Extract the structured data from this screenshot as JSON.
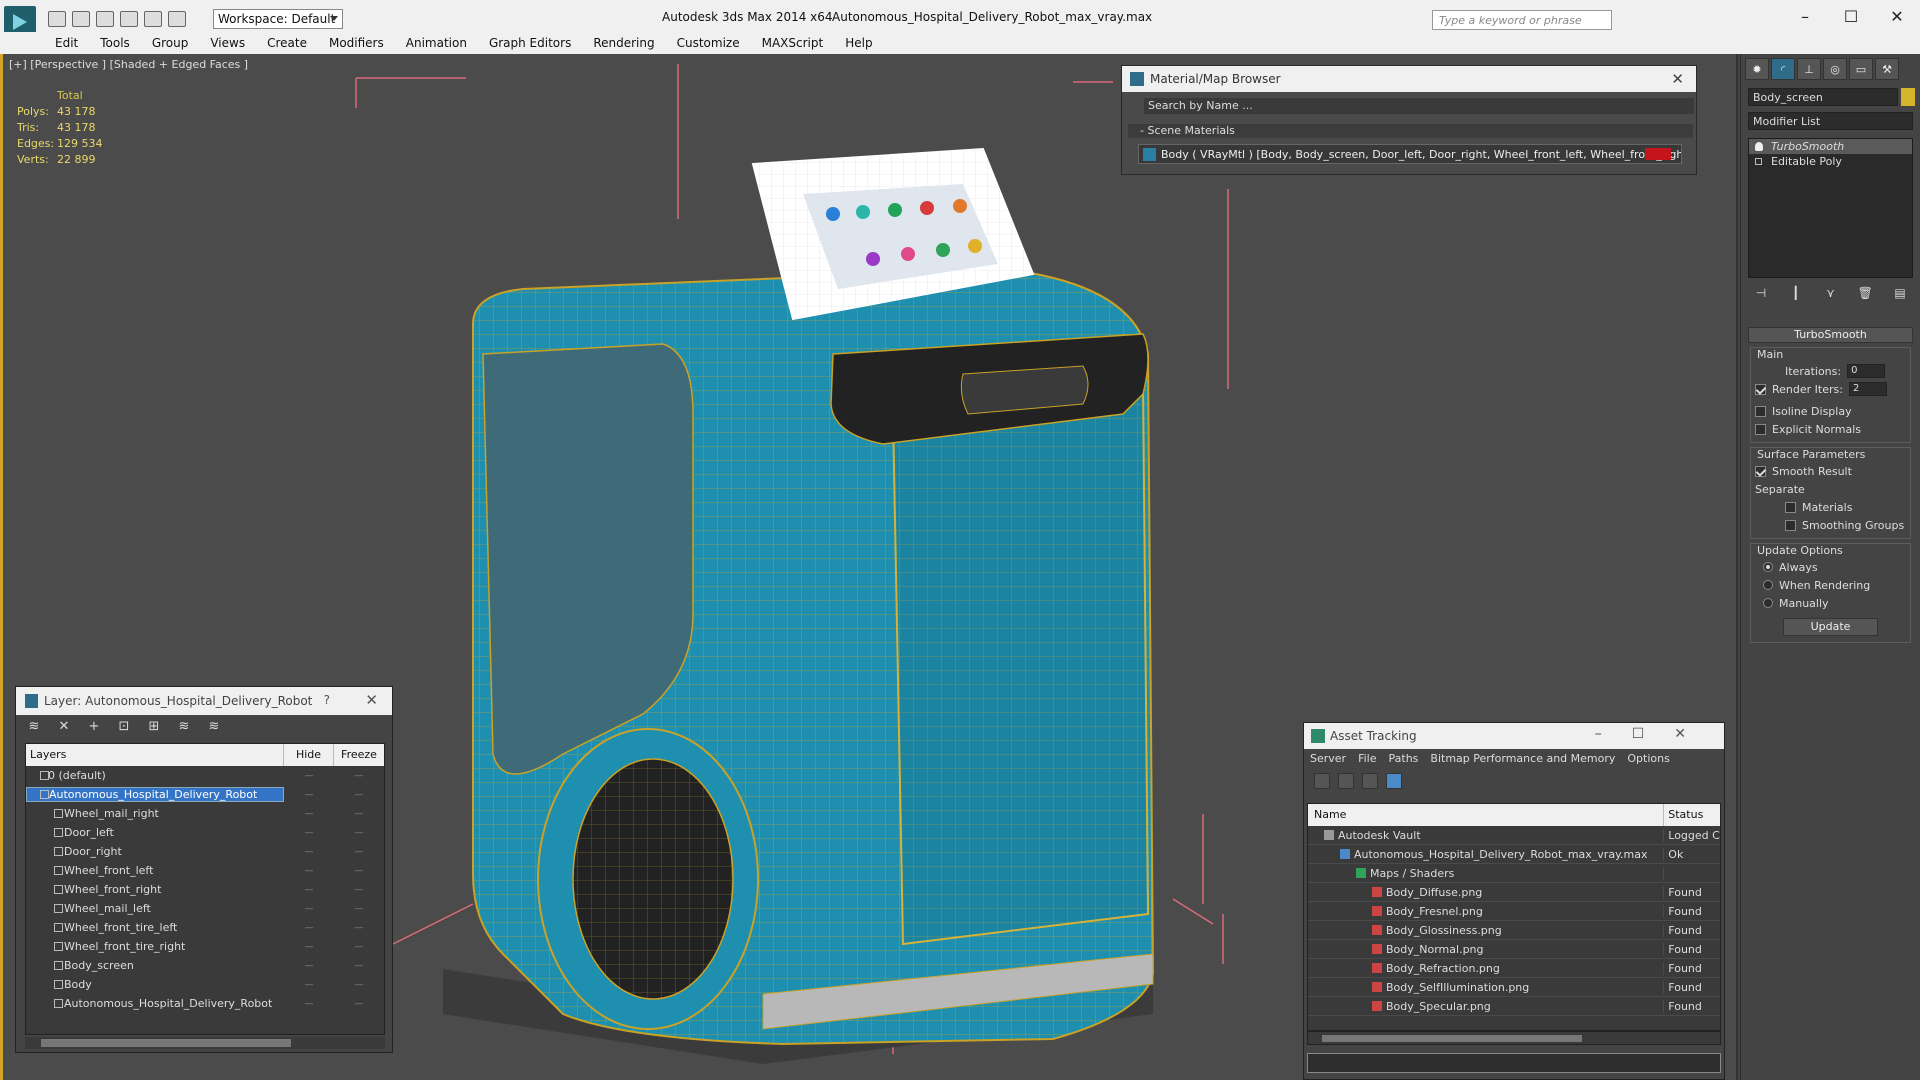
{
  "app": {
    "title": "Autodesk 3ds Max  2014 x64",
    "file": "Autonomous_Hospital_Delivery_Robot_max_vray.max",
    "workspace": "Workspace: Default",
    "search_placeholder": "Type a keyword or phrase"
  },
  "menu": [
    "Edit",
    "Tools",
    "Group",
    "Views",
    "Create",
    "Modifiers",
    "Animation",
    "Graph Editors",
    "Rendering",
    "Customize",
    "MAXScript",
    "Help"
  ],
  "viewport": {
    "label": "[+] [Perspective ] [Shaded + Edged Faces ]",
    "stats": {
      "header": "Total",
      "rows": [
        {
          "label": "Polys:",
          "value": "43 178"
        },
        {
          "label": "Tris:",
          "value": "43 178"
        },
        {
          "label": "Edges:",
          "value": "129 534"
        },
        {
          "label": "Verts:",
          "value": "22 899"
        }
      ]
    }
  },
  "command_panel": {
    "object_name": "Body_screen",
    "modifier_list": "Modifier List",
    "stack": [
      {
        "label": "TurboSmooth",
        "selected": true
      },
      {
        "label": "Editable Poly",
        "selected": false
      }
    ],
    "rollout_title": "TurboSmooth",
    "main_group": "Main",
    "iterations_label": "Iterations:",
    "iterations_value": "0",
    "render_iters_label": "Render Iters:",
    "render_iters_value": "2",
    "isoline_label": "Isoline Display",
    "explicit_normals_label": "Explicit Normals",
    "surface_group": "Surface Parameters",
    "smooth_result_label": "Smooth Result",
    "separate_label": "Separate",
    "materials_label": "Materials",
    "smoothing_groups_label": "Smoothing Groups",
    "update_group": "Update Options",
    "always_label": "Always",
    "when_rendering_label": "When Rendering",
    "manually_label": "Manually",
    "update_button": "Update"
  },
  "material_browser": {
    "title": "Material/Map Browser",
    "search": "Search by Name ...",
    "section": "- Scene Materials",
    "item": "Body ( VRayMtl ) [Body, Body_screen, Door_left, Door_right, Wheel_front_left, Wheel_front_right,..."
  },
  "layer_dialog": {
    "title": "Layer: Autonomous_Hospital_Delivery_Robot",
    "help": "?",
    "columns": {
      "layers": "Layers",
      "hide": "Hide",
      "freeze": "Freeze"
    },
    "rows": [
      {
        "name": "0 (default)",
        "type": "layer"
      },
      {
        "name": "Autonomous_Hospital_Delivery_Robot",
        "type": "layer",
        "selected": true
      },
      {
        "name": "Wheel_mail_right",
        "type": "obj"
      },
      {
        "name": "Door_left",
        "type": "obj"
      },
      {
        "name": "Door_right",
        "type": "obj"
      },
      {
        "name": "Wheel_front_left",
        "type": "obj"
      },
      {
        "name": "Wheel_front_right",
        "type": "obj"
      },
      {
        "name": "Wheel_mail_left",
        "type": "obj"
      },
      {
        "name": "Wheel_front_tire_left",
        "type": "obj"
      },
      {
        "name": "Wheel_front_tire_right",
        "type": "obj"
      },
      {
        "name": "Body_screen",
        "type": "obj"
      },
      {
        "name": "Body",
        "type": "obj"
      },
      {
        "name": "Autonomous_Hospital_Delivery_Robot",
        "type": "obj"
      }
    ]
  },
  "asset_tracking": {
    "title": "Asset Tracking",
    "menu": [
      "Server",
      "File",
      "Paths",
      "Bitmap Performance and Memory",
      "Options"
    ],
    "columns": {
      "name": "Name",
      "status": "Status"
    },
    "rows": [
      {
        "name": "Autodesk Vault",
        "status": "Logged C",
        "indent": 1
      },
      {
        "name": "Autonomous_Hospital_Delivery_Robot_max_vray.max",
        "status": "Ok",
        "indent": 2
      },
      {
        "name": "Maps / Shaders",
        "status": "",
        "indent": 3
      },
      {
        "name": "Body_Diffuse.png",
        "status": "Found",
        "indent": 4
      },
      {
        "name": "Body_Fresnel.png",
        "status": "Found",
        "indent": 4
      },
      {
        "name": "Body_Glossiness.png",
        "status": "Found",
        "indent": 4
      },
      {
        "name": "Body_Normal.png",
        "status": "Found",
        "indent": 4
      },
      {
        "name": "Body_Refraction.png",
        "status": "Found",
        "indent": 4
      },
      {
        "name": "Body_SelfIllumination.png",
        "status": "Found",
        "indent": 4
      },
      {
        "name": "Body_Specular.png",
        "status": "Found",
        "indent": 4
      }
    ]
  },
  "colors": {
    "accent": "#d6a32a",
    "selection": "#3474c6",
    "robot_body": "#1e8fae",
    "wire": "#c9a227"
  }
}
